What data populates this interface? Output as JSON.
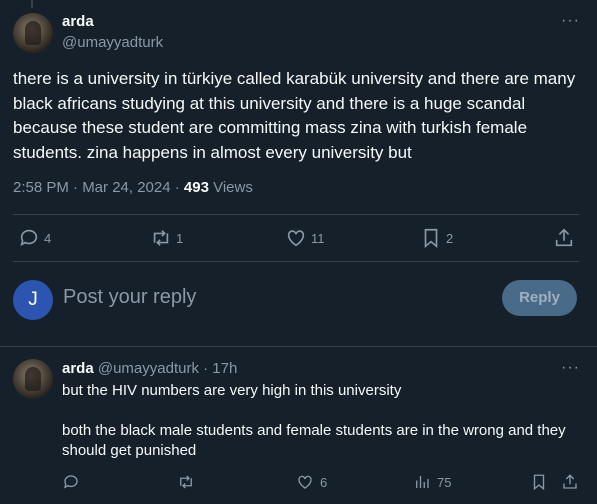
{
  "main_tweet": {
    "display_name": "arda",
    "handle": "@umayyadturk",
    "text": "there is a university in türkiye called karabük university and there are many black africans studying at this university and there is a huge scandal because these student are committing mass zina with turkish female students. zina happens in almost every university but",
    "timestamp": "2:58 PM · Mar 24, 2024 · ",
    "views_count": "493",
    "views_label": " Views",
    "actions": {
      "replies": "4",
      "reposts": "1",
      "likes": "11",
      "bookmarks": "2"
    }
  },
  "reply_composer": {
    "avatar_letter": "J",
    "placeholder": "Post your reply",
    "button_label": "Reply"
  },
  "reply_tweet": {
    "display_name": "arda",
    "handle_time": " @umayyadturk · 17h",
    "paragraphs": [
      "but the HIV numbers are very high in this university",
      "both the black male students and female students are in the wrong and they should get punished"
    ],
    "actions": {
      "likes": "6",
      "views": "75"
    }
  },
  "icons": {
    "more": "more-dots-icon",
    "reply": "reply-icon",
    "repost": "repost-icon",
    "like": "heart-icon",
    "bookmark": "bookmark-icon",
    "share": "share-icon",
    "views": "views-chart-icon"
  },
  "colors": {
    "background": "#15202b",
    "text": "#f7f9f9",
    "muted": "#8b98a5",
    "border": "#38444d",
    "reply_button": "#4a6a8a",
    "avatar_j": "#2b55b0"
  }
}
